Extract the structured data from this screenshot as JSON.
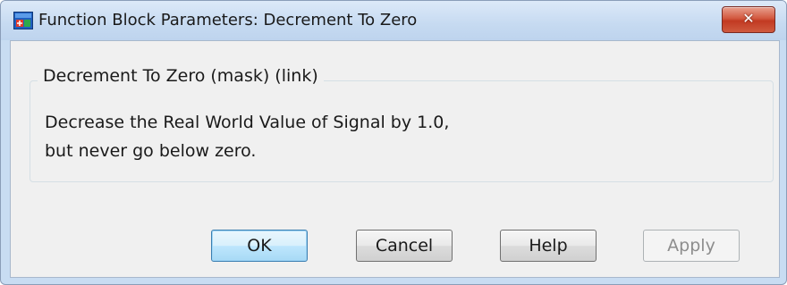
{
  "window": {
    "title": "Function Block Parameters: Decrement To Zero",
    "icon": "simulink-block-icon",
    "close_glyph": "✕"
  },
  "group": {
    "title": "Decrement To Zero (mask) (link)",
    "description_lines": [
      "Decrease the Real World Value of Signal by 1.0,",
      "but never go below zero."
    ]
  },
  "buttons": {
    "ok": "OK",
    "cancel": "Cancel",
    "help": "Help",
    "apply": "Apply"
  },
  "colors": {
    "accent": "#3c7fb1",
    "close_red": "#c23a22",
    "frame": "#c8dcf2"
  }
}
